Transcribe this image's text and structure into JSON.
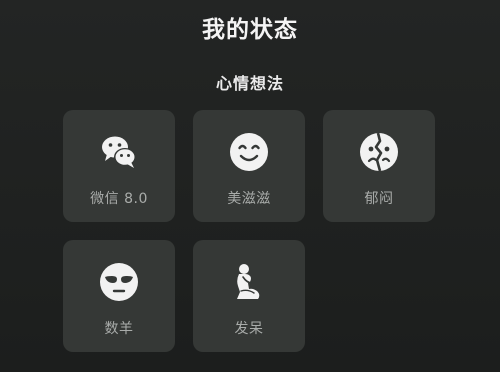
{
  "header": {
    "title": "我的状态"
  },
  "section": {
    "title": "心情想法"
  },
  "statuses": [
    {
      "label": "微信 8.0",
      "icon": "wechat-icon"
    },
    {
      "label": "美滋滋",
      "icon": "smile-face-icon"
    },
    {
      "label": "郁闷",
      "icon": "cracked-face-icon"
    },
    {
      "label": "数羊",
      "icon": "sleepy-face-icon"
    },
    {
      "label": "发呆",
      "icon": "thinker-icon"
    }
  ],
  "colors": {
    "background": "#1e201f",
    "tile": "#353836",
    "icon": "#f2f2f2",
    "label": "#a9acaa"
  }
}
